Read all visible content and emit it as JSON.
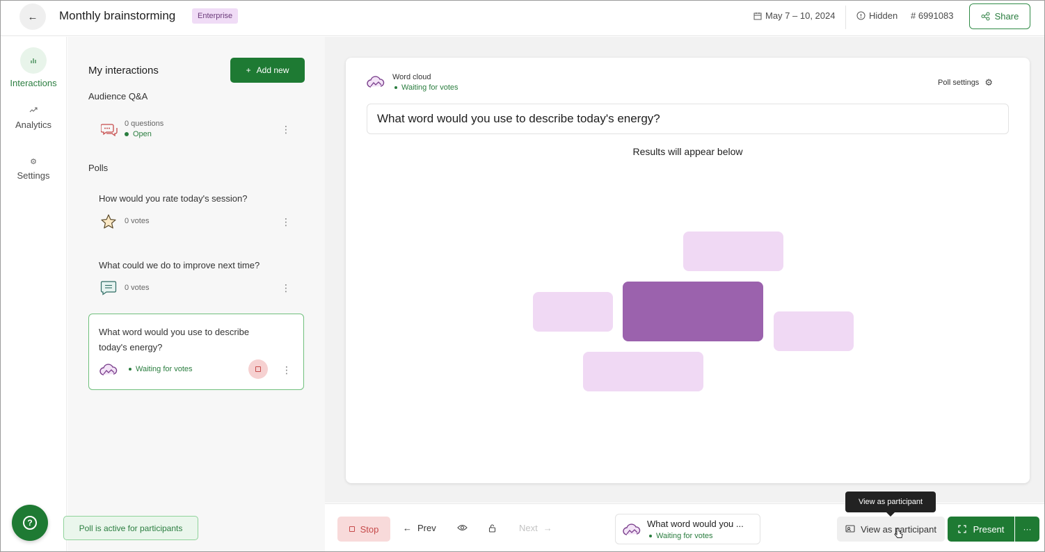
{
  "header": {
    "back_icon": "arrow-left-icon",
    "title": "Monthly brainstorming",
    "plan_badge": "Enterprise",
    "date_range": "May 7 – 10, 2024",
    "visibility": "Hidden",
    "event_code": "# 6991083",
    "share_label": "Share",
    "accent_color": "#1e7a33"
  },
  "rail": {
    "items": [
      {
        "label": "Interactions",
        "icon": "bar-chart-icon",
        "active": true
      },
      {
        "label": "Analytics",
        "icon": "trend-icon",
        "active": false
      },
      {
        "label": "Settings",
        "icon": "gear-icon",
        "active": false
      }
    ],
    "help_icon": "help-icon"
  },
  "panel": {
    "title": "My interactions",
    "add_label": "Add new",
    "qa_section": "Audience Q&A",
    "qa_item": {
      "count": "0 questions",
      "status": "Open"
    },
    "polls_section": "Polls",
    "polls": [
      {
        "question": "How would you rate today's session?",
        "votes": "0 votes",
        "icon": "star-icon"
      },
      {
        "question": "What could we do to improve next time?",
        "votes": "0 votes",
        "icon": "message-icon"
      },
      {
        "question": "What word would you use to describe today's energy?",
        "status": "Waiting for votes",
        "icon": "word-cloud-icon"
      }
    ]
  },
  "toast": "Poll is active for participants",
  "stage": {
    "type_label": "Word cloud",
    "status": "Waiting for votes",
    "settings_label": "Poll settings",
    "question": "What word would you use to describe today's energy?",
    "results_label": "Results will appear below",
    "placeholder_colors": {
      "main": "#9b62ad",
      "light": "#f0d9f4"
    }
  },
  "bottom": {
    "stop_label": "Stop",
    "prev_label": "Prev",
    "next_label": "Next",
    "current_title": "What word would you ...",
    "current_status": "Waiting for votes",
    "tooltip": "View as participant",
    "view_as_label": "View as participant",
    "present_label": "Present",
    "more_label": "···"
  }
}
